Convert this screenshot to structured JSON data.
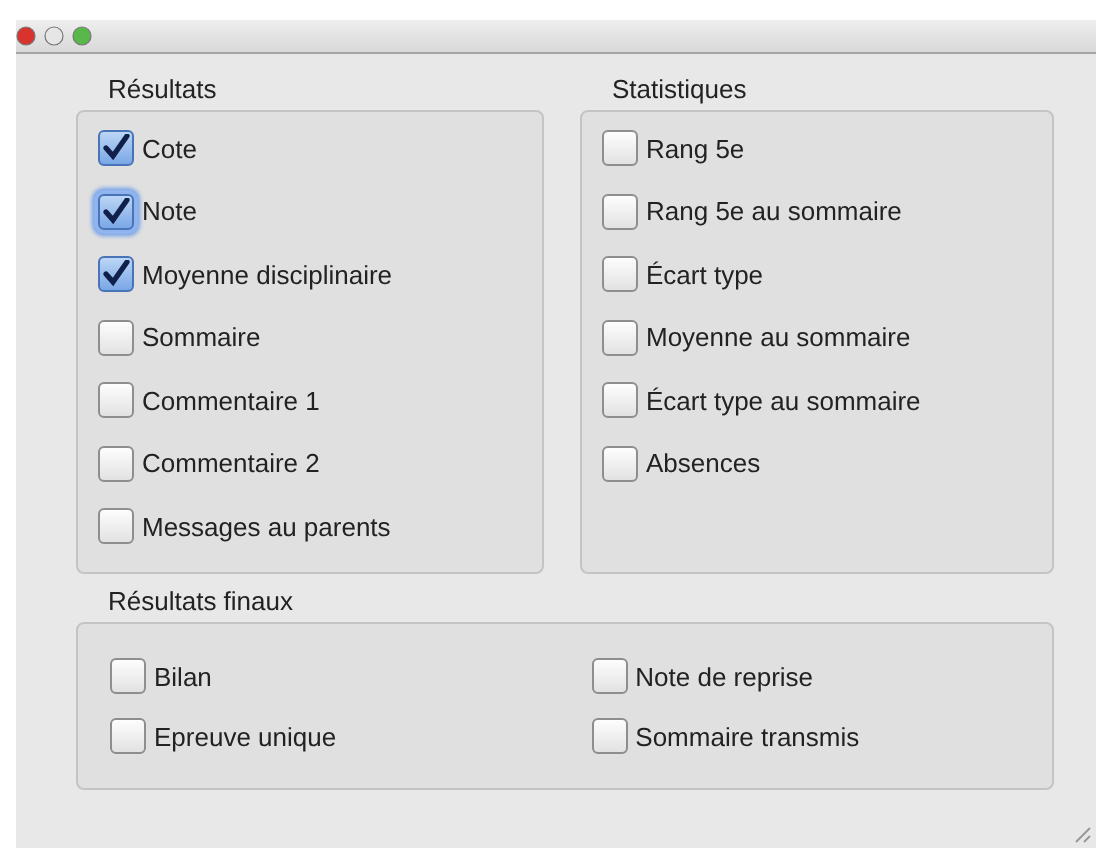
{
  "groups": [
    {
      "title": "Résultats",
      "items": [
        {
          "label": "Cote",
          "checked": true,
          "focused": false
        },
        {
          "label": "Note",
          "checked": true,
          "focused": true
        },
        {
          "label": "Moyenne disciplinaire",
          "checked": true,
          "focused": false
        },
        {
          "label": "Sommaire",
          "checked": false,
          "focused": false
        },
        {
          "label": "Commentaire 1",
          "checked": false,
          "focused": false
        },
        {
          "label": "Commentaire 2",
          "checked": false,
          "focused": false
        },
        {
          "label": "Messages au parents",
          "checked": false,
          "focused": false
        }
      ]
    },
    {
      "title": "Statistiques",
      "items": [
        {
          "label": "Rang 5e",
          "checked": false,
          "focused": false
        },
        {
          "label": "Rang 5e au sommaire",
          "checked": false,
          "focused": false
        },
        {
          "label": "Écart type",
          "checked": false,
          "focused": false
        },
        {
          "label": "Moyenne au sommaire",
          "checked": false,
          "focused": false
        },
        {
          "label": "Écart type au sommaire",
          "checked": false,
          "focused": false
        },
        {
          "label": "Absences",
          "checked": false,
          "focused": false
        }
      ]
    }
  ],
  "final": {
    "title": "Résultats finaux",
    "columns": [
      [
        {
          "label": "Bilan",
          "checked": false,
          "focused": false
        },
        {
          "label": "Epreuve unique",
          "checked": false,
          "focused": false
        }
      ],
      [
        {
          "label": "Note de reprise",
          "checked": false,
          "focused": false
        },
        {
          "label": "Sommaire transmis",
          "checked": false,
          "focused": false
        }
      ]
    ]
  }
}
